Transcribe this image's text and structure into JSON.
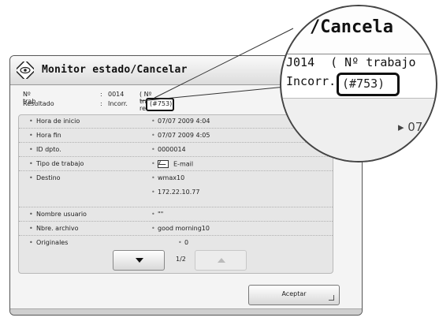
{
  "window": {
    "title": "Monitor estado/Cancelar",
    "title_icon": "monitor-eye-icon"
  },
  "info": {
    "job_label": "Nº trab.",
    "job_value": "0014",
    "job_ref": "( Nº trabajo ref.",
    "result_label": "Resultado",
    "result_value": "Incorr.",
    "result_code": "(#753)"
  },
  "details": [
    {
      "key": "Hora de inicio",
      "value": "07/07 2009 4:04"
    },
    {
      "key": "Hora fin",
      "value": "07/07 2009 4:05"
    },
    {
      "key": "ID dpto.",
      "value": "0000014"
    },
    {
      "key": "Tipo de trabajo",
      "value": "E-mail"
    },
    {
      "key": "Destino",
      "value": "wmax10"
    },
    {
      "key": "",
      "value": "172.22.10.77"
    },
    {
      "key": "Nombre usuario",
      "value": "\"\""
    },
    {
      "key": "Nbre. archivo",
      "value": "good morning10"
    },
    {
      "key": "Originales",
      "value": "0"
    }
  ],
  "pager": {
    "page": "1/2"
  },
  "buttons": {
    "accept": "Aceptar"
  },
  "magnifier": {
    "title_fragment": "/Cancela",
    "job_fragment": "J014",
    "ref_fragment": "( Nº trabajo",
    "result_fragment": "Incorr.",
    "code": "(#753)",
    "value_fragment": "▸ 07"
  }
}
